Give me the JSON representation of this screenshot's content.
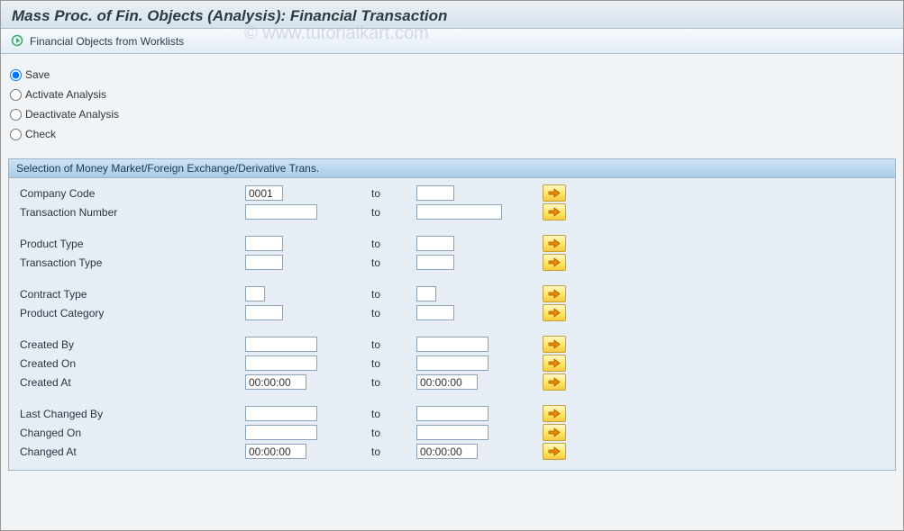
{
  "title": "Mass Proc. of Fin. Objects (Analysis): Financial Transaction",
  "toolbar": {
    "worklists_label": "Financial Objects from Worklists"
  },
  "watermark": "© www.tutorialkart.com",
  "radios": {
    "save": "Save",
    "activate": "Activate Analysis",
    "deactivate": "Deactivate Analysis",
    "check": "Check"
  },
  "panel": {
    "header": "Selection of Money Market/Foreign Exchange/Derivative Trans.",
    "to": "to",
    "rows": {
      "company_code": {
        "label": "Company Code",
        "from": "0001",
        "to": "",
        "wf": "w-s",
        "wt": "w-s"
      },
      "transaction_no": {
        "label": "Transaction Number",
        "from": "",
        "to": "",
        "wf": "w-m",
        "wt": "w-l"
      },
      "product_type": {
        "label": "Product Type",
        "from": "",
        "to": "",
        "wf": "w-s",
        "wt": "w-s"
      },
      "transaction_type": {
        "label": "Transaction Type",
        "from": "",
        "to": "",
        "wf": "w-s",
        "wt": "w-s"
      },
      "contract_type": {
        "label": "Contract Type",
        "from": "",
        "to": "",
        "wf": "w-xs",
        "wt": "w-xs"
      },
      "product_category": {
        "label": "Product Category",
        "from": "",
        "to": "",
        "wf": "w-s",
        "wt": "w-s"
      },
      "created_by": {
        "label": "Created By",
        "from": "",
        "to": "",
        "wf": "w-m",
        "wt": "w-m"
      },
      "created_on": {
        "label": "Created On",
        "from": "",
        "to": "",
        "wf": "w-m",
        "wt": "w-m"
      },
      "created_at": {
        "label": "Created At",
        "from": "00:00:00",
        "to": "00:00:00",
        "wf": "w-t",
        "wt": "w-t"
      },
      "last_changed_by": {
        "label": "Last Changed By",
        "from": "",
        "to": "",
        "wf": "w-m",
        "wt": "w-m"
      },
      "changed_on": {
        "label": "Changed On",
        "from": "",
        "to": "",
        "wf": "w-m",
        "wt": "w-m"
      },
      "changed_at": {
        "label": "Changed At",
        "from": "00:00:00",
        "to": "00:00:00",
        "wf": "w-t",
        "wt": "w-t"
      }
    }
  }
}
